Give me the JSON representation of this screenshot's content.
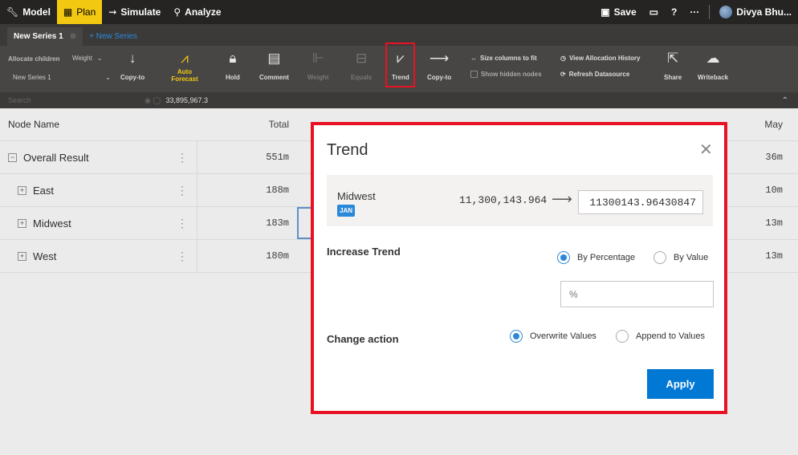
{
  "nav": {
    "items": [
      {
        "label": "Model",
        "icon": "wrench-icon"
      },
      {
        "label": "Plan",
        "icon": "grid-icon"
      },
      {
        "label": "Simulate",
        "icon": "simulate-icon"
      },
      {
        "label": "Analyze",
        "icon": "analyze-icon"
      }
    ],
    "save_label": "Save",
    "user_name": "Divya Bhu..."
  },
  "tabs": {
    "active": "New Series 1",
    "new": "+ New Series"
  },
  "ribbon": {
    "allocate_children": "Allocate children",
    "weight_select": "Weight",
    "series_select": "New Series 1",
    "copy_to_1": "Copy-to",
    "auto_forecast": "Auto Forecast",
    "hold": "Hold",
    "comment": "Comment",
    "weight": "Weight",
    "equals": "Equals",
    "trend": "Trend",
    "copy_to_2": "Copy-to",
    "size_columns": "Size columns to fit",
    "show_hidden": "Show hidden nodes",
    "view_allocation": "View Allocation History",
    "refresh_datasource": "Refresh Datasource",
    "share": "Share",
    "writeback": "Writeback"
  },
  "search": {
    "placeholder": "Search",
    "value": "33,895,967.3"
  },
  "grid": {
    "headers": {
      "node": "Node Name",
      "total": "Total",
      "may": "May"
    },
    "rows": [
      {
        "name": "Overall Result",
        "expander": "−",
        "total": "551m",
        "may": "36m"
      },
      {
        "name": "East",
        "expander": "+",
        "total": "188m",
        "may": "10m"
      },
      {
        "name": "Midwest",
        "expander": "+",
        "total": "183m",
        "may": "13m"
      },
      {
        "name": "West",
        "expander": "+",
        "total": "180m",
        "may": "13m"
      }
    ]
  },
  "dialog": {
    "title": "Trend",
    "member": "Midwest",
    "period": "JAN",
    "current_value": "11,300,143.964",
    "new_value": "11300143.96430847",
    "increase_trend_label": "Increase Trend",
    "by_percentage": "By Percentage",
    "by_value": "By Value",
    "percent_placeholder": "%",
    "change_action_label": "Change action",
    "overwrite": "Overwrite Values",
    "append": "Append to Values",
    "apply": "Apply"
  },
  "colors": {
    "accent": "#0078d4",
    "highlight": "#e81123",
    "nav_active": "#f2c811"
  }
}
